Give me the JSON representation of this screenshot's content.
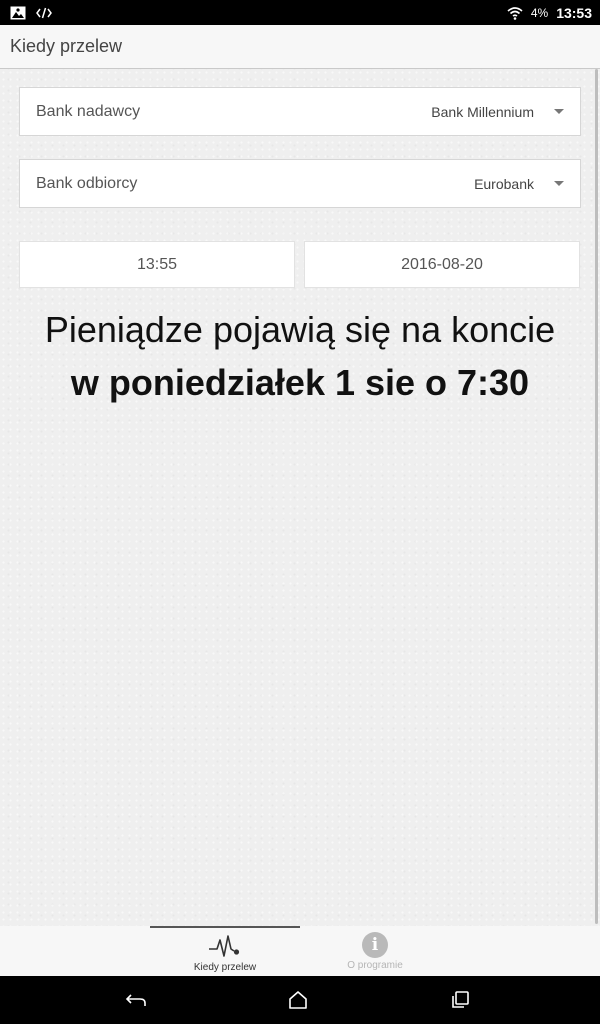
{
  "status_bar": {
    "battery": "4%",
    "clock": "13:53"
  },
  "app_bar": {
    "title": "Kiedy przelew"
  },
  "sender_bank": {
    "label": "Bank nadawcy",
    "value": "Bank Millennium"
  },
  "receiver_bank": {
    "label": "Bank odbiorcy",
    "value": "Eurobank"
  },
  "time": "13:55",
  "date": "2016-08-20",
  "result": {
    "line1": "Pieniądze pojawią się na koncie",
    "line2": "w poniedziałek 1 sie o 7:30"
  },
  "bottom_nav": {
    "tabs": [
      {
        "label": "Kiedy przelew",
        "icon": "pulse-icon",
        "active": true
      },
      {
        "label": "O programie",
        "icon": "info-icon",
        "active": false
      }
    ]
  },
  "colors": {
    "status_bar": "#000000",
    "app_bar": "#f7f7f7",
    "background": "#efefef",
    "text": "#111111"
  }
}
